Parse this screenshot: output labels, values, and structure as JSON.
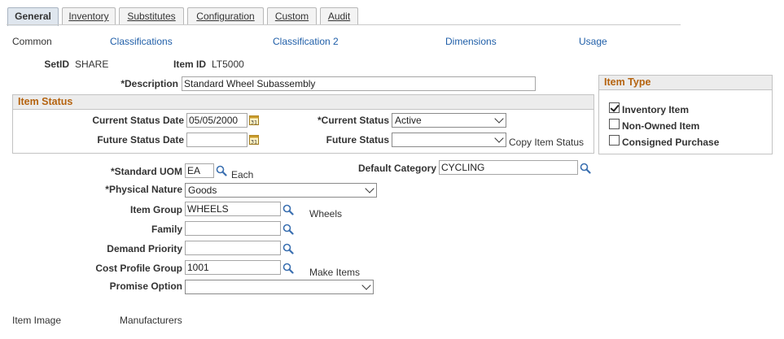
{
  "tabs": [
    {
      "label": "General",
      "active": true
    },
    {
      "label": "Inventory"
    },
    {
      "label": "Substitutes"
    },
    {
      "label": "Configuration"
    },
    {
      "label": "Custom"
    },
    {
      "label": "Audit"
    }
  ],
  "subnav": {
    "common": "Common",
    "classifications": "Classifications",
    "classification2": "Classification 2",
    "dimensions": "Dimensions",
    "usage": "Usage"
  },
  "header": {
    "setid_label": "SetID",
    "setid_value": "SHARE",
    "itemid_label": "Item ID",
    "itemid_value": "LT5000",
    "description_label": "*Description",
    "description_value": "Standard Wheel Subassembly"
  },
  "item_status": {
    "title": "Item Status",
    "current_status_date_label": "Current Status Date",
    "current_status_date_value": "05/05/2000",
    "current_status_label": "*Current Status",
    "current_status_value": "Active",
    "future_status_date_label": "Future Status Date",
    "future_status_date_value": "",
    "future_status_label": "Future Status",
    "future_status_value": "",
    "copy_link": "Copy Item Status",
    "calendar_glyph": "31"
  },
  "item_type": {
    "title": "Item Type",
    "options": [
      {
        "label": "Inventory Item",
        "checked": true
      },
      {
        "label": "Non-Owned Item",
        "checked": false
      },
      {
        "label": "Consigned Purchase",
        "checked": false
      }
    ]
  },
  "details": {
    "standard_uom_label": "*Standard UOM",
    "standard_uom_value": "EA",
    "standard_uom_desc": "Each",
    "default_category_label": "Default Category",
    "default_category_value": "CYCLING",
    "physical_nature_label": "*Physical Nature",
    "physical_nature_value": "Goods",
    "item_group_label": "Item Group",
    "item_group_value": "WHEELS",
    "item_group_desc": "Wheels",
    "family_label": "Family",
    "family_value": "",
    "demand_priority_label": "Demand Priority",
    "demand_priority_value": "",
    "cost_profile_group_label": "Cost Profile Group",
    "cost_profile_group_value": "1001",
    "cost_profile_group_desc": "Make Items",
    "promise_option_label": "Promise Option",
    "promise_option_value": ""
  },
  "footer_links": {
    "item_image": "Item Image",
    "manufacturers": "Manufacturers"
  },
  "colors": {
    "link": "#1f5ea8",
    "group_title": "#b5630f",
    "active_tab": "#dfe6ee"
  },
  "icons": {
    "lookup": "magnifier-icon",
    "calendar": "calendar-icon",
    "dropdown": "chevron-down-icon"
  }
}
